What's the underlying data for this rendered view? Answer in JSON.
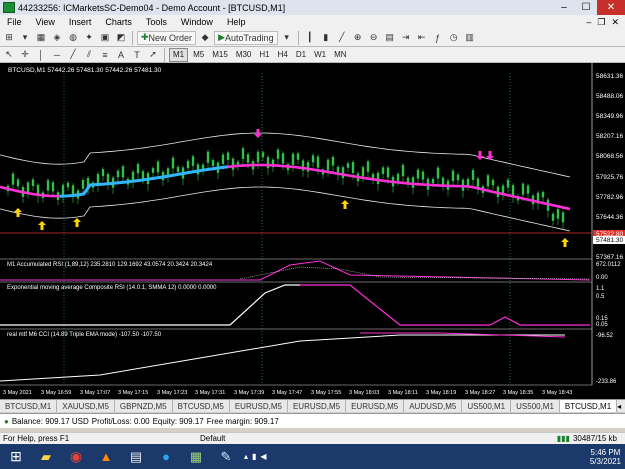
{
  "window": {
    "title": "44233256: ICMarketsSC-Demo04 - Demo Account - [BTCUSD,M1]"
  },
  "menu": [
    "File",
    "View",
    "Insert",
    "Charts",
    "Tools",
    "Window",
    "Help"
  ],
  "toolbar": {
    "new_order": "New Order",
    "autotrading": "AutoTrading"
  },
  "timeframes": [
    "M1",
    "M5",
    "M15",
    "M30",
    "H1",
    "H4",
    "D1",
    "W1",
    "MN"
  ],
  "active_timeframe": "M1",
  "chart": {
    "header": "BTCUSD,M1  57442.26 57481.30 57442.26 57481.30",
    "price_labels": [
      "58631.36",
      "58488.06",
      "58349.96",
      "58207.16",
      "58068.56",
      "57925.76",
      "57782.96",
      "57644.36",
      "57481.30",
      "57367.16"
    ],
    "current_price": "57481.30",
    "red_price": "57522.80",
    "rsi_label": "M1 Accumulated RSI (1,89,12) 235.2810 129.1692 43.0574 20.3424 20.3424",
    "rsi_levels": [
      "672.0112",
      "0.00"
    ],
    "ema_label": "Exponential moving average Composite RSI (14.0.1, SMMA 12) 0.0000 0.0000",
    "ema_levels": [
      "1.1",
      "0.5",
      "0.15",
      "0.05"
    ],
    "cci_label": "real mtf M6 CCI (14.89 Triple EMA mode) -107.50 -107.50",
    "cci_levels": [
      "-96.52",
      "-233.86"
    ],
    "time_labels": [
      "3 May 2021",
      "3 May 16:59",
      "3 May 17:07",
      "3 May 17:15",
      "3 May 17:23",
      "3 May 17:31",
      "3 May 17:39",
      "3 May 17:47",
      "3 May 17:55",
      "3 May 18:03",
      "3 May 18:11",
      "3 May 18:19",
      "3 May 18:27",
      "3 May 18:35",
      "3 May 18:43"
    ],
    "colors": {
      "up_arrow": "#ffd400",
      "down_arrow": "#ff2fd6",
      "ma_blue": "#2fb6ff",
      "ma_magenta": "#ff2fd6",
      "candle": "#2fc24a",
      "envelope": "#e8e8e8"
    }
  },
  "symbol_tabs": [
    "BTCUSD,M1",
    "XAUUSD,M5",
    "GBPNZD,M5",
    "BTCUSD,M5",
    "EURUSD,M5",
    "EURUSD,M5",
    "EURUSD,M5",
    "AUDUSD,M5",
    "US500,M1",
    "US500,M1",
    "BTCUSD,M1"
  ],
  "active_symbol_tab": 10,
  "account": {
    "balance": "Balance: 909.17 USD",
    "profit": "Profit/Loss: 0.00",
    "equity": "Equity: 909.17",
    "free_margin": "Free margin: 909.17"
  },
  "status": {
    "help": "For Help, press F1",
    "profile": "Default",
    "traffic": "30487/15 kb"
  },
  "clock": {
    "time": "5:46 PM",
    "date": "5/3/2021"
  }
}
